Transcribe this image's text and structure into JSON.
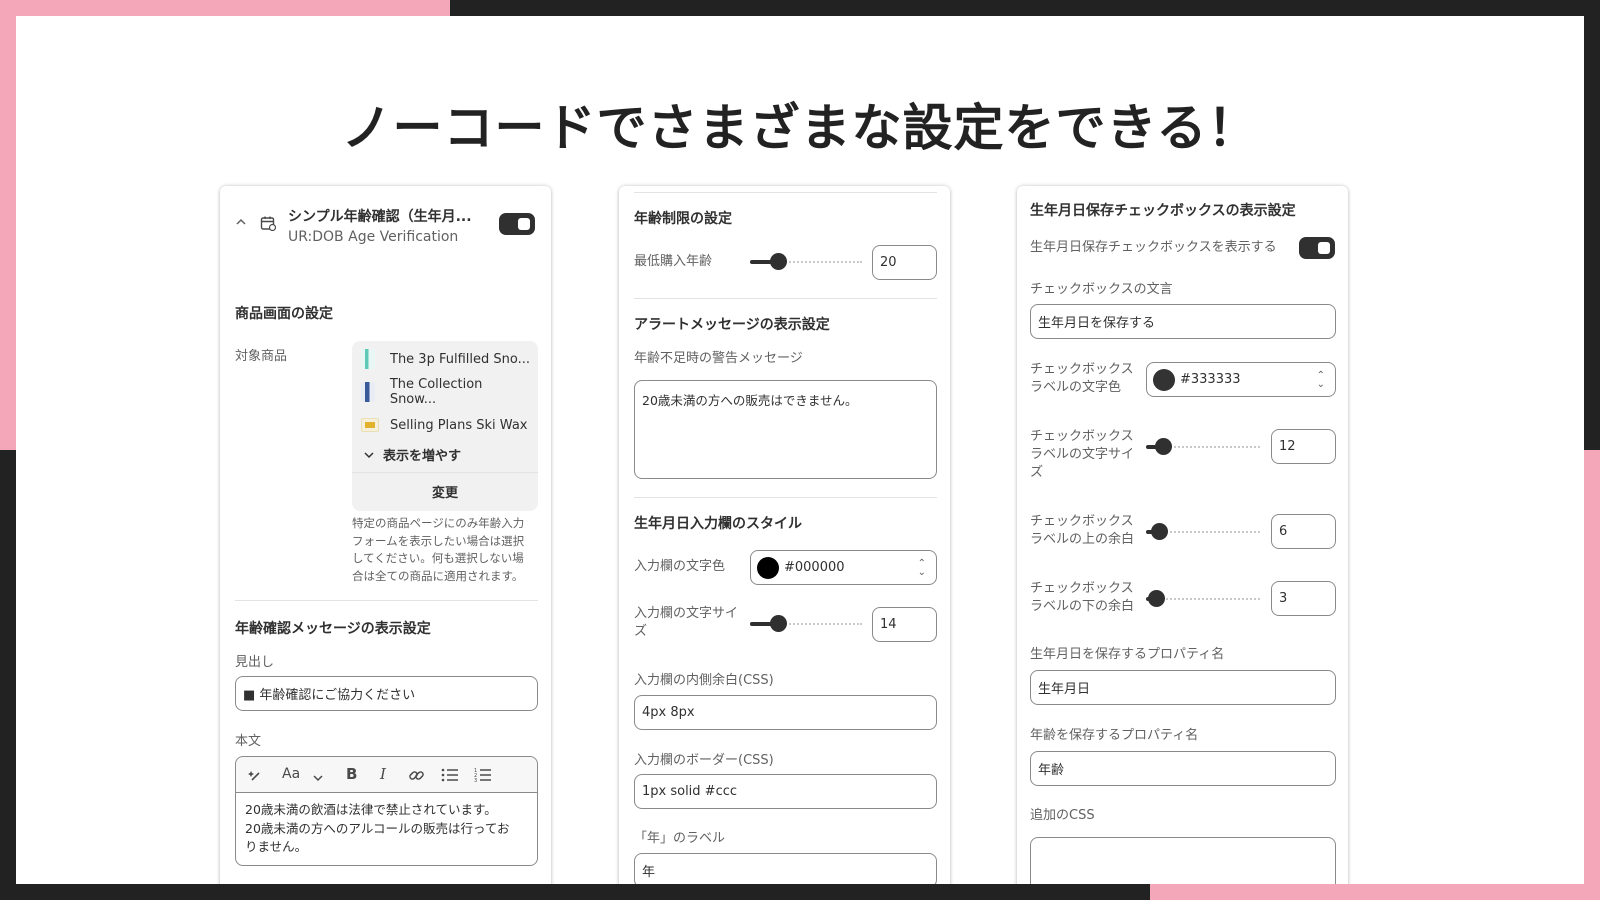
{
  "headline": "ノーコードでさまざまな設定をできる！",
  "colors": {
    "accent_pink": "#f4a7b9",
    "dark": "#222222",
    "toggle_on": "#303030"
  },
  "panel1": {
    "app_title": "シンプル年齢確認（生年月...",
    "app_subtitle": "UR:DOB Age Verification",
    "app_icon": "calendar-icon",
    "enabled": true,
    "product_section_title": "商品画面の設定",
    "target_products_label": "対象商品",
    "products": [
      "The 3p Fulfilled Sno...",
      "The Collection Snow...",
      "Selling Plans Ski Wax"
    ],
    "show_more": "表示を増やす",
    "change_button": "変更",
    "help_line1": "特定の商品ページにのみ年齢入力",
    "help_line2": "フォームを表示したい場合は選択",
    "help_line3": "してください。何も選択しない場",
    "help_line4": "合は全ての商品に適用されます。",
    "message_section_title": "年齢確認メッセージの表示設定",
    "heading_label": "見出し",
    "heading_value": "■ 年齢確認にご協力ください",
    "body_label": "本文",
    "toolbar_font": "Aa",
    "toolbar_bold": "B",
    "toolbar_italic": "I",
    "body_line1": "20歳未満の飲酒は法律で禁止されています。",
    "body_line2": "20歳未満の方へのアルコールの販売は行ってお",
    "body_line3": "りません。"
  },
  "panel2": {
    "age_section_title": "年齢制限の設定",
    "min_age_label": "最低購入年齢",
    "min_age_value": "20",
    "alert_section_title": "アラートメッセージの表示設定",
    "warning_label": "年齢不足時の警告メッセージ",
    "warning_value": "20歳未満の方への販売はできません。",
    "style_section_title": "生年月日入力欄のスタイル",
    "text_color_label": "入力欄の文字色",
    "text_color_value": "#000000",
    "font_size_label_line1": "入力欄の文字サイ",
    "font_size_label_line2": "ズ",
    "font_size_value": "14",
    "padding_label": "入力欄の内側余白(CSS)",
    "padding_value": "4px 8px",
    "border_label": "入力欄のボーダー(CSS)",
    "border_value": "1px solid #ccc",
    "year_label_label": "「年」のラベル",
    "year_label_value": "年"
  },
  "panel3": {
    "section_title": "生年月日保存チェックボックスの表示設定",
    "show_checkbox_label": "生年月日保存チェックボックスを表示する",
    "show_checkbox_enabled": true,
    "checkbox_text_label": "チェックボックスの文言",
    "checkbox_text_value": "生年月日を保存する",
    "label_color_line1": "チェックボックス",
    "label_color_line2": "ラベルの文字色",
    "label_color_value": "#333333",
    "label_size_line1": "チェックボックス",
    "label_size_line2": "ラベルの文字サイ",
    "label_size_line3": "ズ",
    "label_size_value": "12",
    "margin_top_line1": "チェックボックス",
    "margin_top_line2": "ラベルの上の余白",
    "margin_top_value": "6",
    "margin_bottom_line1": "チェックボックス",
    "margin_bottom_line2": "ラベルの下の余白",
    "margin_bottom_value": "3",
    "dob_property_label": "生年月日を保存するプロパティ名",
    "dob_property_value": "生年月日",
    "age_property_label": "年齢を保存するプロパティ名",
    "age_property_value": "年齢",
    "extra_css_label": "追加のCSS",
    "extra_css_value": ""
  },
  "sliders": {
    "min_age_fill": 0.25,
    "font_size_fill": 0.25,
    "label_size_fill": 0.15,
    "margin_top_fill": 0.11,
    "margin_bottom_fill": 0.09
  }
}
